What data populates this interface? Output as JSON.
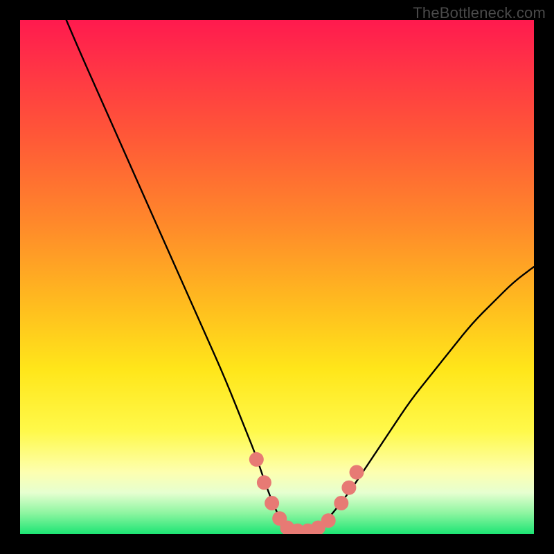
{
  "watermark": "TheBottleneck.com",
  "chart_data": {
    "type": "line",
    "title": "",
    "xlabel": "",
    "ylabel": "",
    "xlim": [
      0,
      100
    ],
    "ylim": [
      0,
      100
    ],
    "series": [
      {
        "name": "bottleneck-curve",
        "x": [
          9,
          12,
          16,
          20,
          24,
          28,
          32,
          36,
          40,
          44,
          46,
          48,
          50,
          52,
          54,
          56,
          58,
          60,
          64,
          68,
          72,
          76,
          80,
          84,
          88,
          92,
          96,
          100
        ],
        "y": [
          100,
          93,
          84,
          75,
          66,
          57,
          48,
          39,
          30,
          20,
          15,
          9,
          4,
          1,
          0,
          0,
          1,
          3,
          8,
          14,
          20,
          26,
          31,
          36,
          41,
          45,
          49,
          52
        ]
      }
    ],
    "markers": {
      "name": "highlight-dots",
      "color": "#e77a74",
      "points": [
        {
          "x": 46.0,
          "y": 14.5
        },
        {
          "x": 47.5,
          "y": 10.0
        },
        {
          "x": 49.0,
          "y": 6.0
        },
        {
          "x": 50.5,
          "y": 3.0
        },
        {
          "x": 52.0,
          "y": 1.2
        },
        {
          "x": 54.0,
          "y": 0.6
        },
        {
          "x": 56.0,
          "y": 0.6
        },
        {
          "x": 58.0,
          "y": 1.2
        },
        {
          "x": 60.0,
          "y": 2.6
        },
        {
          "x": 62.5,
          "y": 6.0
        },
        {
          "x": 64.0,
          "y": 9.0
        },
        {
          "x": 65.5,
          "y": 12.0
        }
      ]
    },
    "gradient_stops": [
      {
        "pos": 0.0,
        "color": "#ff1a4e"
      },
      {
        "pos": 0.4,
        "color": "#ff8a2a"
      },
      {
        "pos": 0.68,
        "color": "#ffe61a"
      },
      {
        "pos": 0.92,
        "color": "#e6ffd0"
      },
      {
        "pos": 1.0,
        "color": "#1de574"
      }
    ]
  }
}
